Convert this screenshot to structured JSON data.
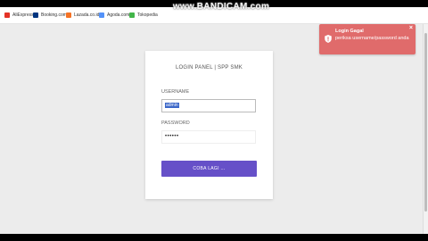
{
  "bookmarks": [
    {
      "label": "AliExpress",
      "color": "#e43226"
    },
    {
      "label": "Booking.com",
      "color": "#003580"
    },
    {
      "label": "Lazada.co.id",
      "color": "#f57224"
    },
    {
      "label": "Agoda.com",
      "color": "#5392f9"
    },
    {
      "label": "Tokopedia",
      "color": "#42b549"
    }
  ],
  "watermark": "www.BANDICAM.com",
  "login": {
    "title": "LOGIN PANEL | SPP SMK",
    "username_label": "USERNAME",
    "username_value": "admin",
    "password_label": "PASSWORD",
    "password_value": "••••••",
    "submit_label": "COBA LAGI ..."
  },
  "toast": {
    "title": "Login Gagal",
    "message": "periksa username/password anda",
    "color": "#e06b6b"
  }
}
